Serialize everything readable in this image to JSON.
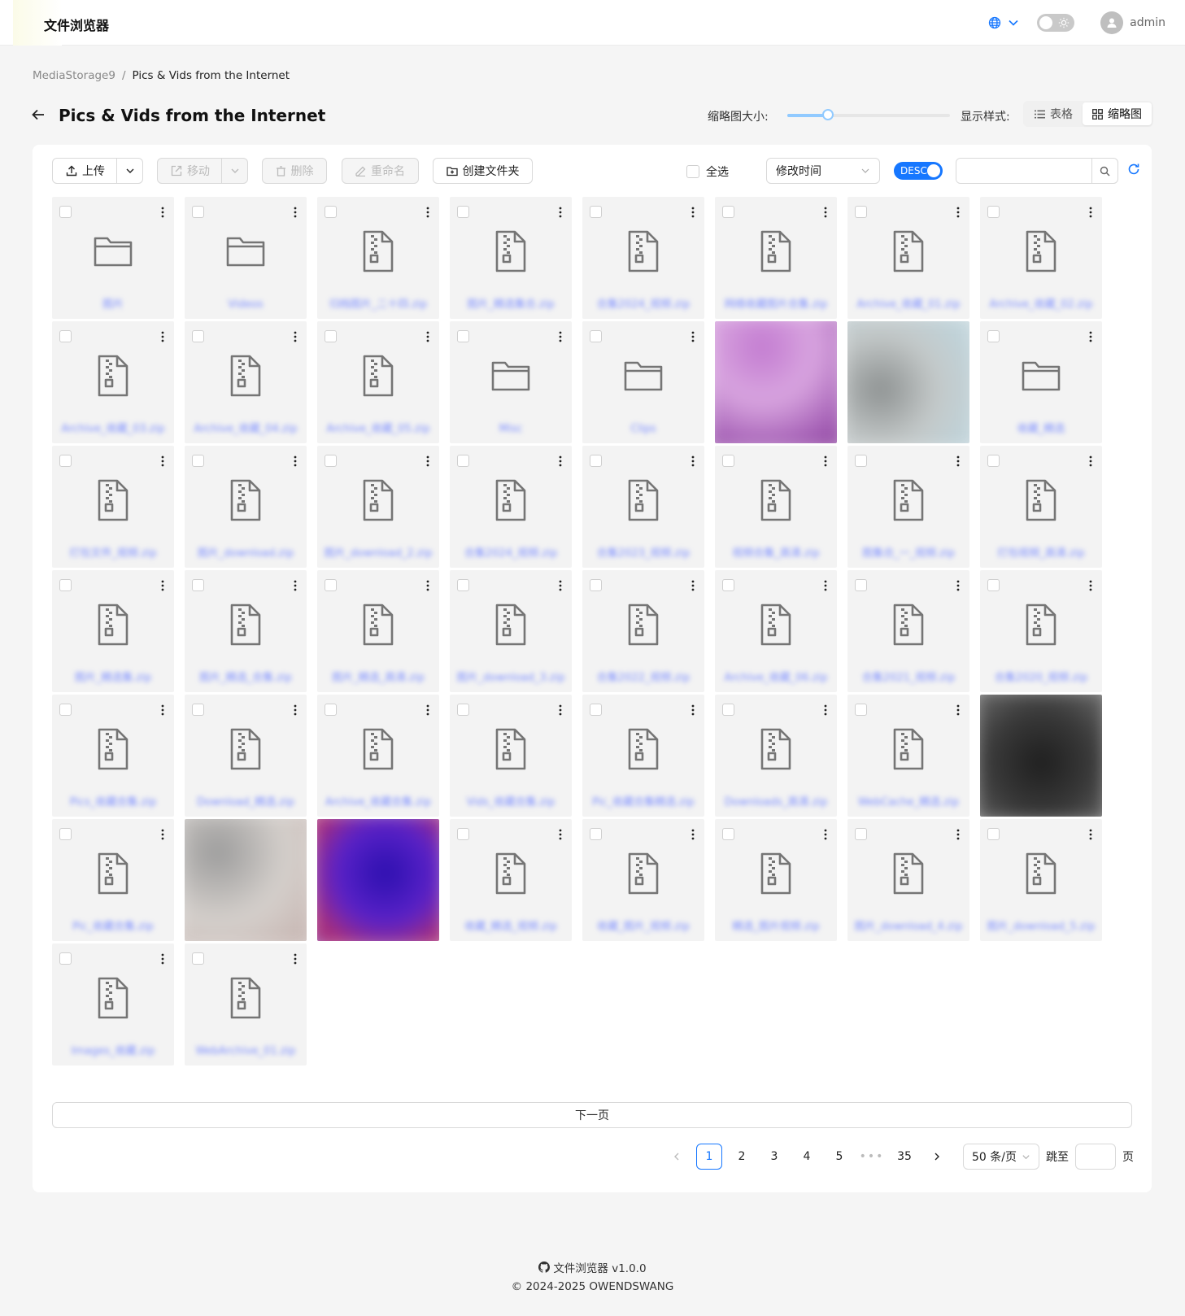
{
  "app": {
    "title": "文件浏览器"
  },
  "header": {
    "username": "admin"
  },
  "breadcrumb": {
    "root": "MediaStorage9",
    "separator": "/",
    "current": "Pics & Vids from the Internet"
  },
  "page": {
    "title": "Pics & Vids from the Internet"
  },
  "view_controls": {
    "thumbnail_size_label": "缩略图大小:",
    "thumbnail_size_fraction": 0.25,
    "display_style_label": "显示样式:",
    "table_label": "表格",
    "thumbnail_label": "缩略图"
  },
  "toolbar": {
    "upload_label": "上传",
    "move_label": "移动",
    "delete_label": "删除",
    "rename_label": "重命名",
    "create_folder_label": "创建文件夹",
    "select_all_label": "全选",
    "sort_by": "修改时间",
    "order_label": "DESC",
    "search_value": ""
  },
  "files": {
    "rows": [
      [
        {
          "type": "folder",
          "name": "图片"
        },
        {
          "type": "folder",
          "name": "Videos"
        },
        {
          "type": "archive",
          "name": "归档图片_二十四.zip"
        },
        {
          "type": "archive",
          "name": "图片_精选集合.zip"
        },
        {
          "type": "archive",
          "name": "合集2024_视频.zip"
        },
        {
          "type": "archive",
          "name": "网络收藏图片合集.zip"
        },
        {
          "type": "archive",
          "name": "Archive_收藏_01.zip"
        },
        {
          "type": "archive",
          "name": "Archive_收藏_02.zip"
        }
      ],
      [
        {
          "type": "archive",
          "name": "Archive_收藏_03.zip"
        },
        {
          "type": "archive",
          "name": "Archive_收藏_04.zip"
        },
        {
          "type": "archive",
          "name": "Archive_收藏_05.zip"
        },
        {
          "type": "folder",
          "name": "Misc"
        },
        {
          "type": "folder",
          "name": "Clips"
        },
        {
          "type": "image",
          "name": ""
        },
        {
          "type": "image",
          "name": ""
        },
        {
          "type": "folder",
          "name": "收藏_精选"
        }
      ],
      [
        {
          "type": "archive",
          "name": "打包文件_视频.zip"
        },
        {
          "type": "archive",
          "name": "图片_download.zip"
        },
        {
          "type": "archive",
          "name": "图片_download_2.zip"
        },
        {
          "type": "archive",
          "name": "合集2024_视频.zip"
        },
        {
          "type": "archive",
          "name": "合集2023_视频.zip"
        },
        {
          "type": "archive",
          "name": "视频合集_高清.zip"
        },
        {
          "type": "archive",
          "name": "图集合_一_视频.zip"
        },
        {
          "type": "archive",
          "name": "打包视频_高清.zip"
        }
      ],
      [
        {
          "type": "archive",
          "name": "图片_精选集.zip"
        },
        {
          "type": "archive",
          "name": "图片_精选_合集.zip"
        },
        {
          "type": "archive",
          "name": "图片_精选_高清.zip"
        },
        {
          "type": "archive",
          "name": "图片_download_3.zip"
        },
        {
          "type": "archive",
          "name": "合集2022_视频.zip"
        },
        {
          "type": "archive",
          "name": "Archive_收藏_06.zip"
        },
        {
          "type": "archive",
          "name": "合集2021_视频.zip"
        },
        {
          "type": "archive",
          "name": "合集2020_视频.zip"
        }
      ],
      [
        {
          "type": "archive",
          "name": "Pics_收藏合集.zip"
        },
        {
          "type": "archive",
          "name": "Download_精选.zip"
        },
        {
          "type": "archive",
          "name": "Archive_收藏合集.zip"
        },
        {
          "type": "archive",
          "name": "Vids_收藏合集.zip"
        },
        {
          "type": "archive",
          "name": "Pic_收藏合集精选.zip"
        },
        {
          "type": "archive",
          "name": "Downloads_高清.zip"
        },
        {
          "type": "archive",
          "name": "WebCache_精选.zip"
        },
        {
          "type": "image",
          "name": ""
        }
      ],
      [
        {
          "type": "archive",
          "name": "Pic_收藏合集.zip"
        },
        {
          "type": "image",
          "name": ""
        },
        {
          "type": "image",
          "name": ""
        },
        {
          "type": "archive",
          "name": "收藏_精选_视频.zip"
        },
        {
          "type": "archive",
          "name": "收藏_图片_视频.zip"
        },
        {
          "type": "archive",
          "name": "精选_图片视频.zip"
        },
        {
          "type": "archive",
          "name": "图片_download_4.zip"
        },
        {
          "type": "archive",
          "name": "图片_download_5.zip"
        }
      ],
      [
        {
          "type": "archive",
          "name": "Images_收藏.zip"
        },
        {
          "type": "archive",
          "name": "WebArchive_01.zip"
        }
      ]
    ]
  },
  "pagination": {
    "next_page_label": "下一页",
    "pages": [
      "1",
      "2",
      "3",
      "4",
      "5"
    ],
    "ellipsis": "•••",
    "last_page": "35",
    "current_page": "1",
    "page_size": "50 条/页",
    "jump_label": "跳至",
    "page_suffix": "页",
    "jump_value": ""
  },
  "footer": {
    "line1": "文件浏览器 v1.0.0",
    "line2": "© 2024-2025 OWENDSWANG"
  },
  "colors": {
    "accent": "#1677ff",
    "tile_bg": "#f3f3f3",
    "page_bg": "#f5f5f5"
  }
}
